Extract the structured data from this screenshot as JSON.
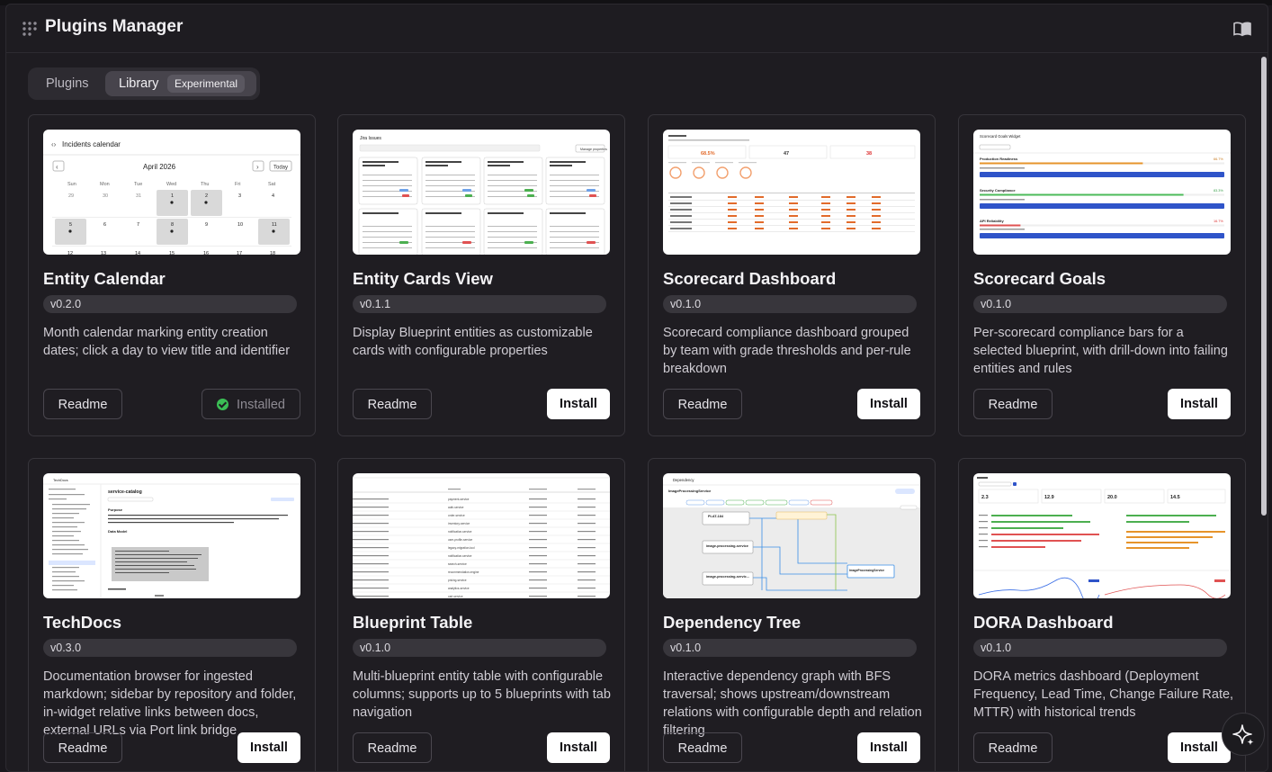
{
  "app": {
    "title": "Plugins Manager",
    "icons": {
      "app": "grid-dots-icon",
      "docs": "book-open-icon",
      "assistant": "sparkles-icon"
    }
  },
  "tabs": [
    {
      "label": "Plugins",
      "active": false
    },
    {
      "label": "Library",
      "active": true,
      "badge": "Experimental"
    }
  ],
  "cards": [
    {
      "name": "Entity Calendar",
      "version": "v0.2.0",
      "description": "Month calendar marking entity creation dates; click a day to view title and identifier",
      "readme": "Readme",
      "action": "Installed",
      "installed": true,
      "preview": {
        "title": "Incidents calendar",
        "month": "April 2026",
        "today": "Today",
        "weekdays": [
          "Sun",
          "Mon",
          "Tue",
          "Wed",
          "Thu",
          "Fri",
          "Sat"
        ],
        "days": [
          "29",
          "30",
          "31",
          "1",
          "2",
          "3",
          "4",
          "5",
          "6",
          "7",
          "8",
          "9",
          "10",
          "11",
          "12",
          "13",
          "14",
          "15",
          "16",
          "17",
          "18"
        ]
      }
    },
    {
      "name": "Entity Cards View",
      "version": "v0.1.1",
      "description": "Display Blueprint entities as customizable cards with configurable properties",
      "readme": "Readme",
      "action": "Install",
      "installed": false,
      "preview": {
        "title": "Jira Issues",
        "button": "Manage properties"
      }
    },
    {
      "name": "Scorecard Dashboard",
      "version": "v0.1.0",
      "description": "Scorecard compliance dashboard grouped by team with grade thresholds and per-rule breakdown",
      "readme": "Readme",
      "action": "Install",
      "installed": false,
      "preview": {
        "stats": [
          "68.5%",
          "47",
          "38"
        ]
      }
    },
    {
      "name": "Scorecard Goals",
      "version": "v0.1.0",
      "description": "Per-scorecard compliance bars for a selected blueprint, with drill-down into failing entities and rules",
      "readme": "Readme",
      "action": "Install",
      "installed": false,
      "preview": {
        "title": "Scorecard Goals Widget",
        "rows": [
          {
            "label": "Production Readiness",
            "pct": "66.7%",
            "fill": 0.667
          },
          {
            "label": "Security Compliance",
            "pct": "83.3%",
            "fill": 0.833
          },
          {
            "label": "API Reliability",
            "pct": "16.7%",
            "fill": 0.167
          }
        ]
      }
    },
    {
      "name": "TechDocs",
      "version": "v0.3.0",
      "description": "Documentation browser for ingested markdown; sidebar by repository and folder, in-widget relative links between docs, external URLs via Port link bridge",
      "readme": "Readme",
      "action": "Install",
      "installed": false,
      "preview": {
        "title": "TechDocs",
        "doc": "service-catalog",
        "section1": "Purpose",
        "section2": "Data Model"
      }
    },
    {
      "name": "Blueprint Table",
      "version": "v0.1.0",
      "description": "Multi-blueprint entity table with configurable columns; supports up to 5 blueprints with tab navigation",
      "readme": "Readme",
      "action": "Install",
      "installed": false,
      "preview": {
        "rows": [
          "payment-service",
          "auth-service",
          "order-service",
          "inventory-service",
          "notification-service",
          "user-profile-service",
          "legacy-migration-tool",
          "notification-service",
          "search-service",
          "recommendation-engine",
          "pricing-service",
          "analytics-service",
          "cart-service"
        ]
      }
    },
    {
      "name": "Dependency Tree",
      "version": "v0.1.0",
      "description": "Interactive dependency graph with BFS traversal; shows upstream/downstream relations with configurable depth and relation filtering",
      "readme": "Readme",
      "action": "Install",
      "installed": false,
      "preview": {
        "title": "Dependency",
        "root": "ImageProcessingService",
        "nodes": [
          "PLAT-184",
          "image-processing-service",
          "image-processing-servic...",
          "ImageProcessingService"
        ]
      }
    },
    {
      "name": "DORA Dashboard",
      "version": "v0.1.0",
      "description": "DORA metrics dashboard (Deployment Frequency, Lead Time, Change Failure Rate, MTTR) with historical trends",
      "readme": "Readme",
      "action": "Install",
      "installed": false,
      "preview": {
        "stats": [
          "2.3",
          "12.9",
          "20.0",
          "14.5"
        ]
      }
    }
  ],
  "colors": {
    "background": "#1a181d",
    "card": "#1f1d22",
    "installed": "#3bbf55",
    "goal_bar": "#2f54c9"
  }
}
